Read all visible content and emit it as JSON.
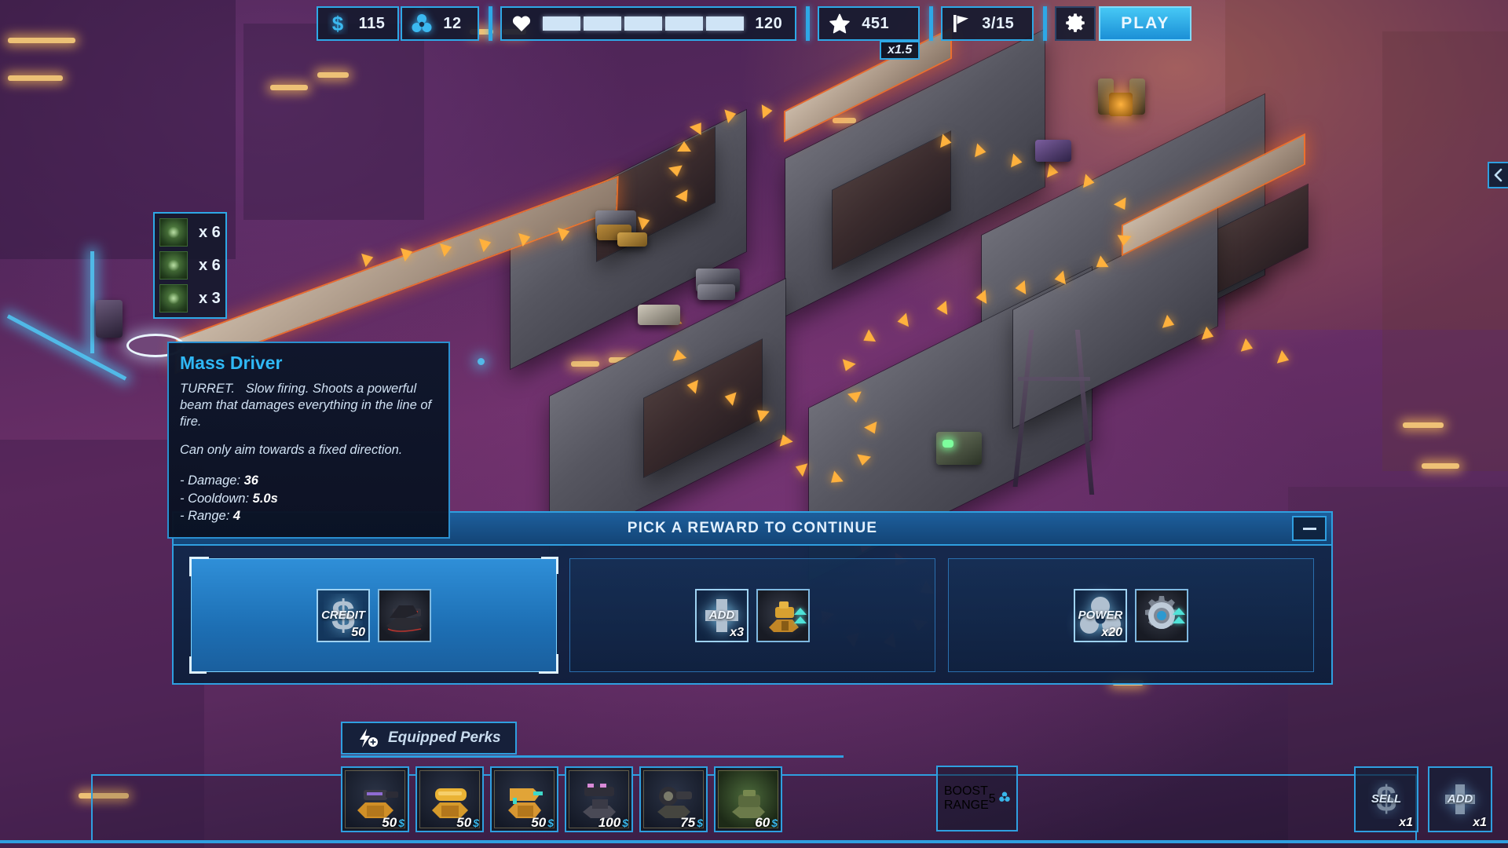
{
  "hud": {
    "credits": {
      "icon": "dollar-icon",
      "value": "115"
    },
    "power": {
      "icon": "power-trefoil-icon",
      "value": "12"
    },
    "health": {
      "icon": "heart-icon",
      "value": "120",
      "segments": 5
    },
    "score": {
      "icon": "star-icon",
      "value": "451",
      "multiplier": "x1.5"
    },
    "waves": {
      "icon": "flag-icon",
      "value": "3/15"
    },
    "settings_icon": "gear-icon",
    "play_label": "PLAY"
  },
  "wave_panel": {
    "rows": [
      {
        "icon": "enemy-thumb-icon",
        "count": "x 6"
      },
      {
        "icon": "enemy-thumb-icon",
        "count": "x 6"
      },
      {
        "icon": "enemy-thumb-icon",
        "count": "x 3"
      }
    ]
  },
  "tooltip": {
    "title": "Mass Driver",
    "category": "TURRET.",
    "description": "Slow firing. Shoots a powerful beam that damages everything in the line of fire.",
    "note": "Can only aim towards a fixed direction.",
    "stats": [
      {
        "label": "- Damage:",
        "value": "36"
      },
      {
        "label": "- Cooldown:",
        "value": "5.0s"
      },
      {
        "label": "- Range:",
        "value": "4"
      }
    ]
  },
  "reward_panel": {
    "title": "PICK A REWARD TO CONTINUE",
    "minimize_icon": "minimize-icon",
    "cards": [
      {
        "selected": true,
        "tiles": [
          {
            "kind": "label",
            "label": "CREDIT",
            "qty": "50",
            "icon": "dollar-icon"
          },
          {
            "kind": "item",
            "label": "",
            "qty": "",
            "icon": "turret-mass-driver-icon"
          }
        ]
      },
      {
        "selected": false,
        "tiles": [
          {
            "kind": "label",
            "label": "ADD",
            "qty": "x3",
            "icon": "plus-icon"
          },
          {
            "kind": "item",
            "label": "",
            "qty": "",
            "icon": "turret-gold-icon",
            "chevrons": 2
          }
        ]
      },
      {
        "selected": false,
        "tiles": [
          {
            "kind": "label",
            "label": "POWER",
            "qty": "x20",
            "icon": "power-trefoil-icon"
          },
          {
            "kind": "item",
            "label": "",
            "qty": "",
            "icon": "perk-gear-icon",
            "chevrons": 2
          }
        ]
      }
    ]
  },
  "perks_tab": {
    "icon": "lightning-plus-icon",
    "label": "Equipped Perks"
  },
  "shop": {
    "items": [
      {
        "name": "turret-cannon",
        "price": "50",
        "currency": "$"
      },
      {
        "name": "turret-gatling",
        "price": "50",
        "currency": "$"
      },
      {
        "name": "turret-mortar",
        "price": "50",
        "currency": "$"
      },
      {
        "name": "turret-heavy",
        "price": "100",
        "currency": "$"
      },
      {
        "name": "turret-laser",
        "price": "75",
        "currency": "$"
      },
      {
        "name": "turret-green",
        "price": "60",
        "currency": "$"
      }
    ]
  },
  "boost": {
    "label_line1": "BOOST",
    "label_line2": "RANGE",
    "qty": "5",
    "currency_icon": "power-trefoil-icon"
  },
  "actions": [
    {
      "name": "sell-button",
      "label": "SELL",
      "qty": "x1",
      "icon": "dollar-icon"
    },
    {
      "name": "add-button",
      "label": "ADD",
      "qty": "x1",
      "icon": "plus-icon"
    }
  ],
  "edge_collapse": {
    "icon": "chevron-left-icon"
  },
  "colors": {
    "accent_blue": "#2ea8e6",
    "panel_bg": "#0d162a",
    "title_cyan": "#2fb8f5",
    "selected_blue": "#2f8fd8",
    "path_orange": "#ffb13d",
    "enemy_red": "#e8574e"
  }
}
